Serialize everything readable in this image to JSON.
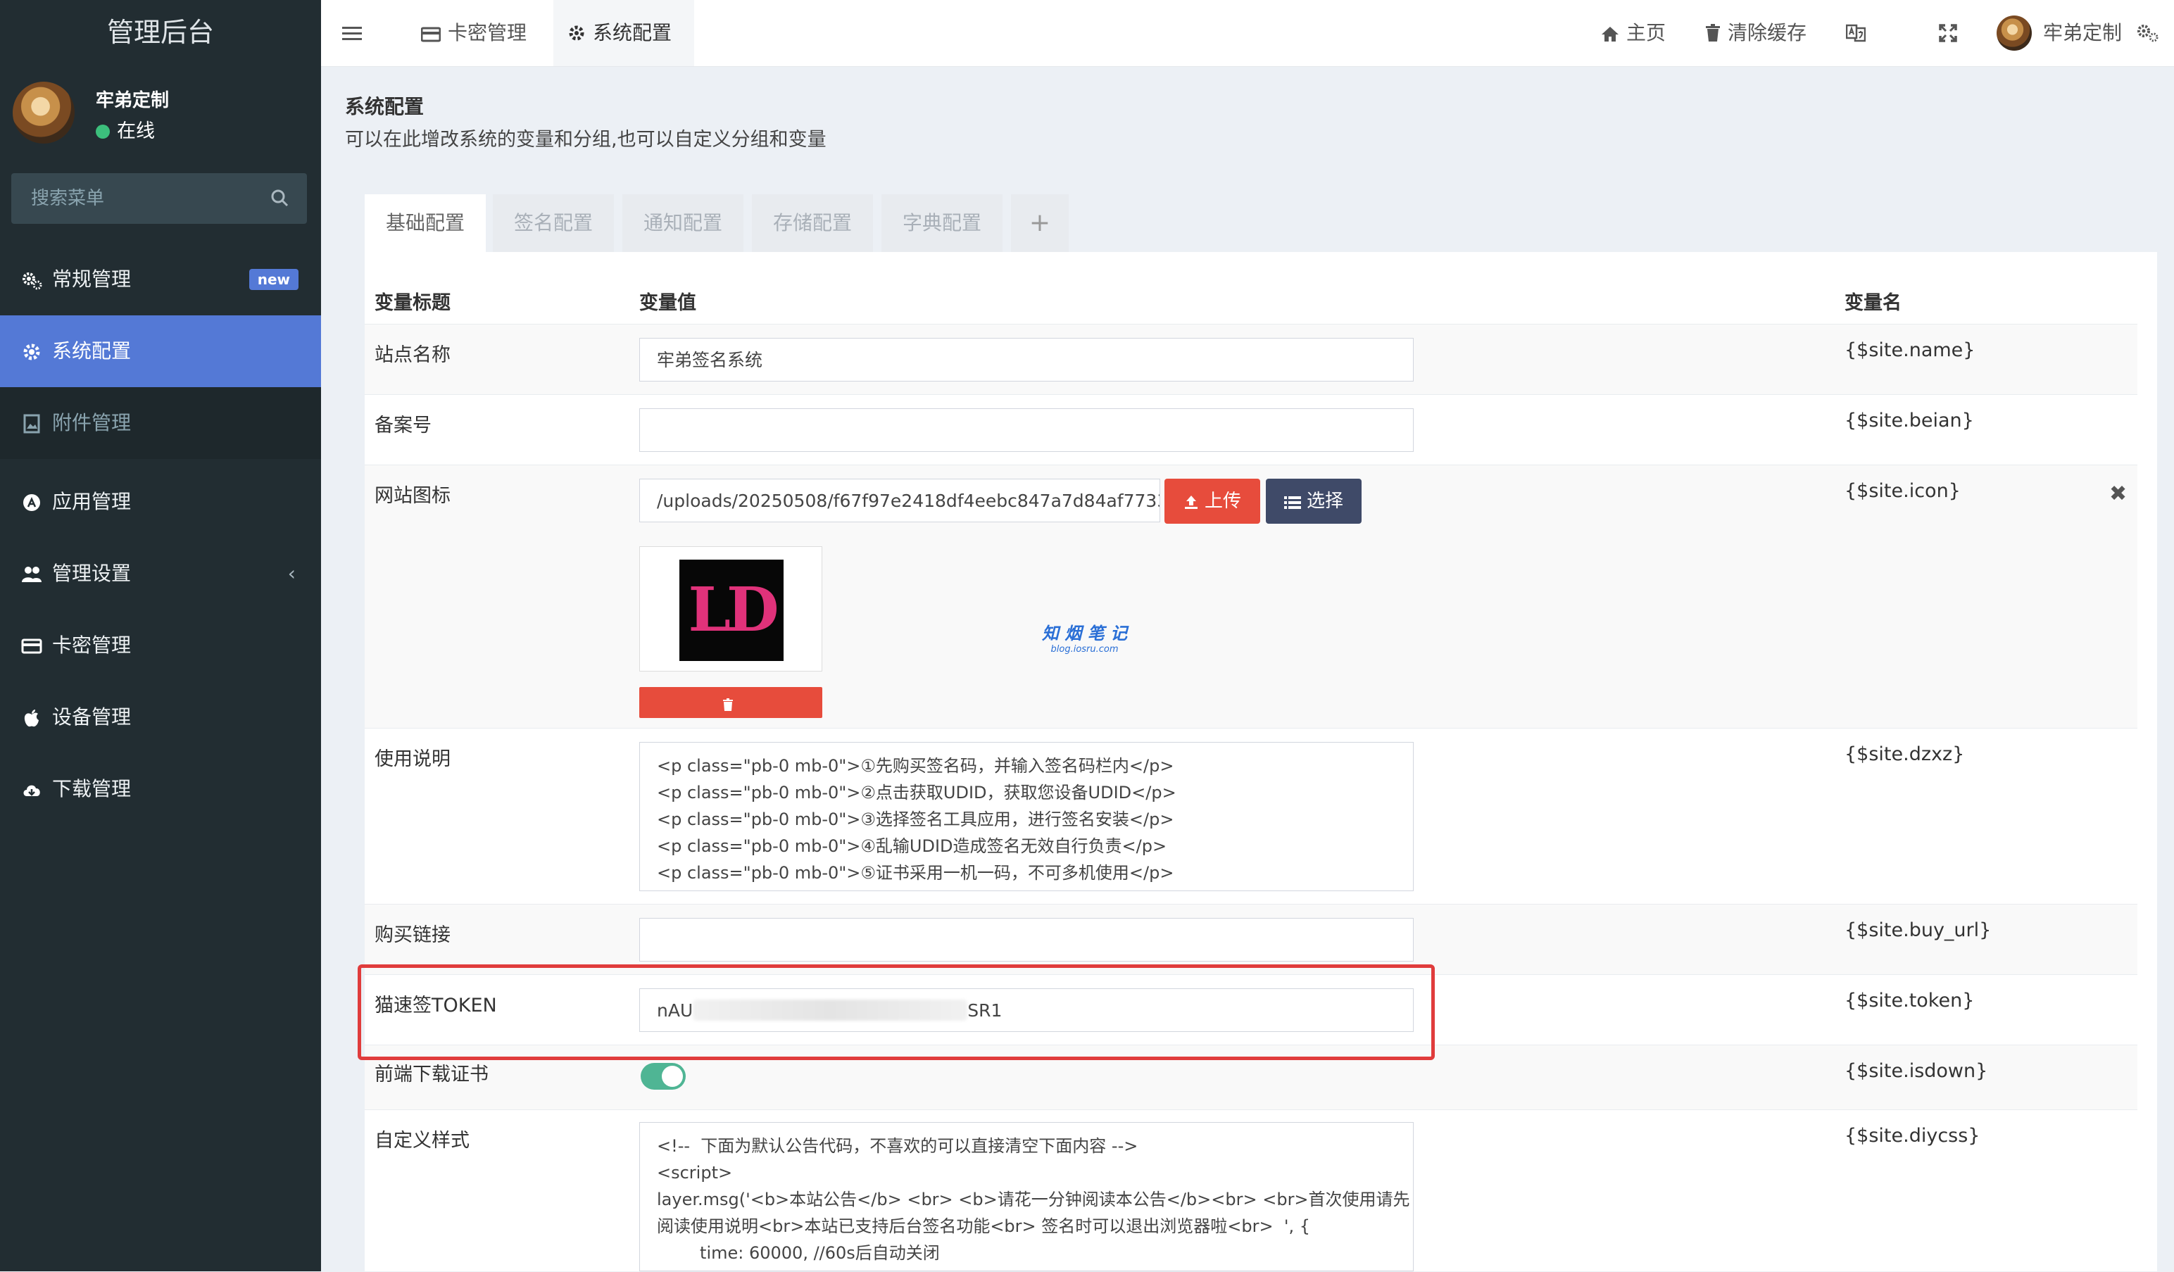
{
  "sidebar": {
    "logo": "管理后台",
    "user": {
      "name": "牢弟定制",
      "status": "在线"
    },
    "search": {
      "placeholder": "搜索菜单"
    },
    "items": [
      {
        "label": "常规管理",
        "icon": "cogs-icon",
        "badge": "new"
      },
      {
        "label": "系统配置",
        "icon": "gear-icon"
      },
      {
        "label": "附件管理",
        "icon": "image-file-icon"
      },
      {
        "label": "应用管理",
        "icon": "app-store-icon"
      },
      {
        "label": "管理设置",
        "icon": "users-icon"
      },
      {
        "label": "卡密管理",
        "icon": "credit-card-icon"
      },
      {
        "label": "设备管理",
        "icon": "apple-icon"
      },
      {
        "label": "下载管理",
        "icon": "cloud-download-icon"
      }
    ]
  },
  "topnav": {
    "tabs": [
      {
        "label": "卡密管理",
        "icon": "credit-card-icon"
      },
      {
        "label": "系统配置",
        "icon": "gear-icon"
      }
    ],
    "home": "主页",
    "clear_cache": "清除缓存",
    "user_name": "牢弟定制"
  },
  "panel": {
    "title": "系统配置",
    "description": "可以在此增改系统的变量和分组,也可以自定义分组和变量",
    "tabs": [
      "基础配置",
      "签名配置",
      "通知配置",
      "存储配置",
      "字典配置",
      "+"
    ]
  },
  "table": {
    "headers": {
      "title": "变量标题",
      "value": "变量值",
      "name": "变量名"
    },
    "rows": {
      "site_name": {
        "label": "站点名称",
        "value": "牢弟签名系统",
        "var": "{$site.name}"
      },
      "beian": {
        "label": "备案号",
        "value": "",
        "var": "{$site.beian}"
      },
      "icon": {
        "label": "网站图标",
        "value": "/uploads/20250508/f67f97e2418df4eebc847a7d84af7733.png",
        "var": "{$site.icon}",
        "upload_label": "上传",
        "choose_label": "选择",
        "preview_text": "LD"
      },
      "dzxz": {
        "label": "使用说明",
        "value": "<p class=\"pb-0 mb-0\">①先购买签名码，并输入签名码栏内</p>\n<p class=\"pb-0 mb-0\">②点击获取UDID，获取您设备UDID</p>\n<p class=\"pb-0 mb-0\">③选择签名工具应用，进行签名安装</p>\n<p class=\"pb-0 mb-0\">④乱输UDID造成签名无效自行负责</p>\n<p class=\"pb-0 mb-0\">⑤证书采用一机一码，不可多机使用</p>",
        "var": "{$site.dzxz}"
      },
      "buy_url": {
        "label": "购买链接",
        "value": "",
        "var": "{$site.buy_url}"
      },
      "token": {
        "label": "猫速签TOKEN",
        "value_prefix": "nAU",
        "value_suffix": "SR1",
        "var": "{$site.token}"
      },
      "isdown": {
        "label": "前端下载证书",
        "enabled": true,
        "var": "{$site.isdown}"
      },
      "diycss": {
        "label": "自定义样式",
        "value": "<!--  下面为默认公告代码，不喜欢的可以直接清空下面内容 -->\n<script>\nlayer.msg('<b>本站公告</b> <br> <b>请花一分钟阅读本公告</b><br> <br>首次使用请先\n阅读使用说明<br>本站已支持后台签名功能<br> 签名时可以退出浏览器啦<br>  ', {\n        time: 60000, //60s后自动关闭",
        "var": "{$site.diycss}"
      }
    }
  },
  "watermark": {
    "line1": "知 烟 笔 记",
    "line2": "blog.iosru.com"
  },
  "colors": {
    "sidebar_bg": "#222d32",
    "accent": "#5479d6",
    "danger": "#e74c3c",
    "dark_btn": "#3f4a68",
    "toggle": "#4fb594"
  }
}
